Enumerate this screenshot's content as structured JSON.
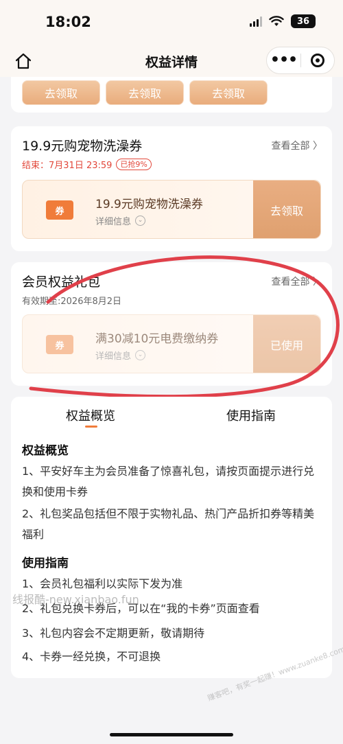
{
  "status_bar": {
    "time": "18:02",
    "battery": "36"
  },
  "nav": {
    "title": "权益详情",
    "more_icon": "•••"
  },
  "top_buttons": [
    "去领取",
    "去领取",
    "去领取"
  ],
  "coupon_card": {
    "title": "19.9元购宠物洗澡券",
    "more": "查看全部 〉",
    "end_label": "结束：7月31日 23:59",
    "badge": "已抢9%",
    "coupon": {
      "icon_text": "券",
      "title": "19.9元购宠物洗澡券",
      "detail": "详细信息",
      "button": "去领取"
    }
  },
  "gift_card": {
    "title": "会员权益礼包",
    "more": "查看全部 〉",
    "valid": "有效期至:2026年8月2日",
    "coupon": {
      "icon_text": "券",
      "title": "满30减10元电费缴纳券",
      "detail": "详细信息",
      "button": "已使用"
    }
  },
  "tabs": {
    "overview": "权益概览",
    "guide": "使用指南"
  },
  "overview": {
    "title": "权益概览",
    "items": [
      "1、平安好车主为会员准备了惊喜礼包，请按页面提示进行兑换和使用卡券",
      "2、礼包奖品包括但不限于实物礼品、热门产品折扣券等精美福利"
    ]
  },
  "guide": {
    "title": "使用指南",
    "items": [
      "1、会员礼包福利以实际下发为准",
      "2、礼包兑换卡券后，可以在“我的卡券”页面查看",
      "3、礼包内容会不定期更新，敬请期待",
      "4、卡券一经兑换，不可退换"
    ]
  },
  "watermarks": [
    "线报酷-new.xianbao.fun",
    "赚客吧，有奖一起赚！www.zuanke8.com"
  ],
  "colors": {
    "accent": "#f07c3a",
    "button": "#e3a475",
    "annotation": "#e0404a"
  }
}
